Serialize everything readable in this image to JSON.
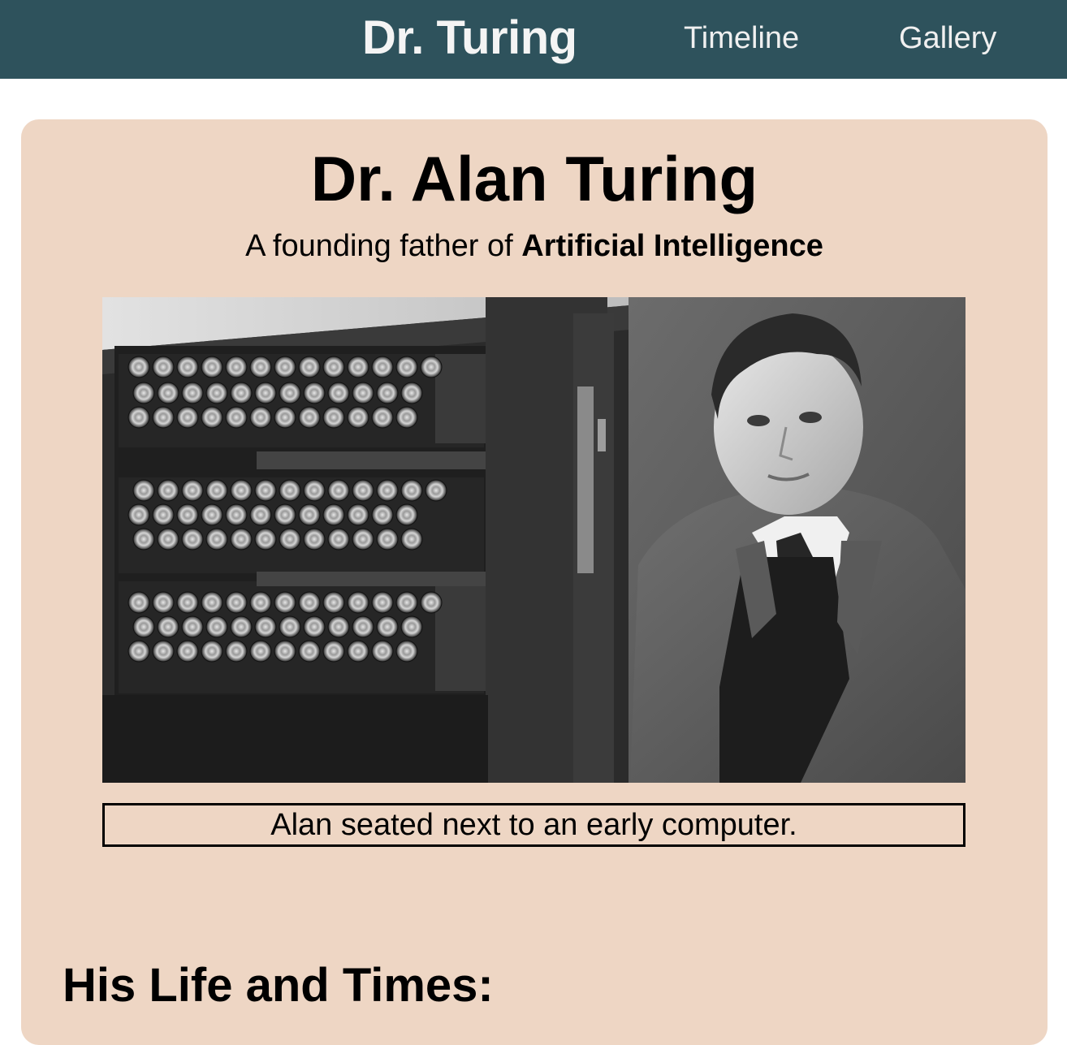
{
  "navbar": {
    "brand": "Dr. Turing",
    "links": [
      {
        "label": "Timeline"
      },
      {
        "label": "Gallery"
      }
    ],
    "background_color": "#2e525c"
  },
  "hero": {
    "title": "Dr. Alan Turing",
    "subtitle_prefix": "A founding father of ",
    "subtitle_emphasis": "Artificial Intelligence",
    "image_description": "photo-turing-and-bombe-machine",
    "caption": "Alan seated next to an early computer.",
    "card_color": "#eed6c4"
  },
  "section": {
    "heading": "His Life and Times:"
  }
}
